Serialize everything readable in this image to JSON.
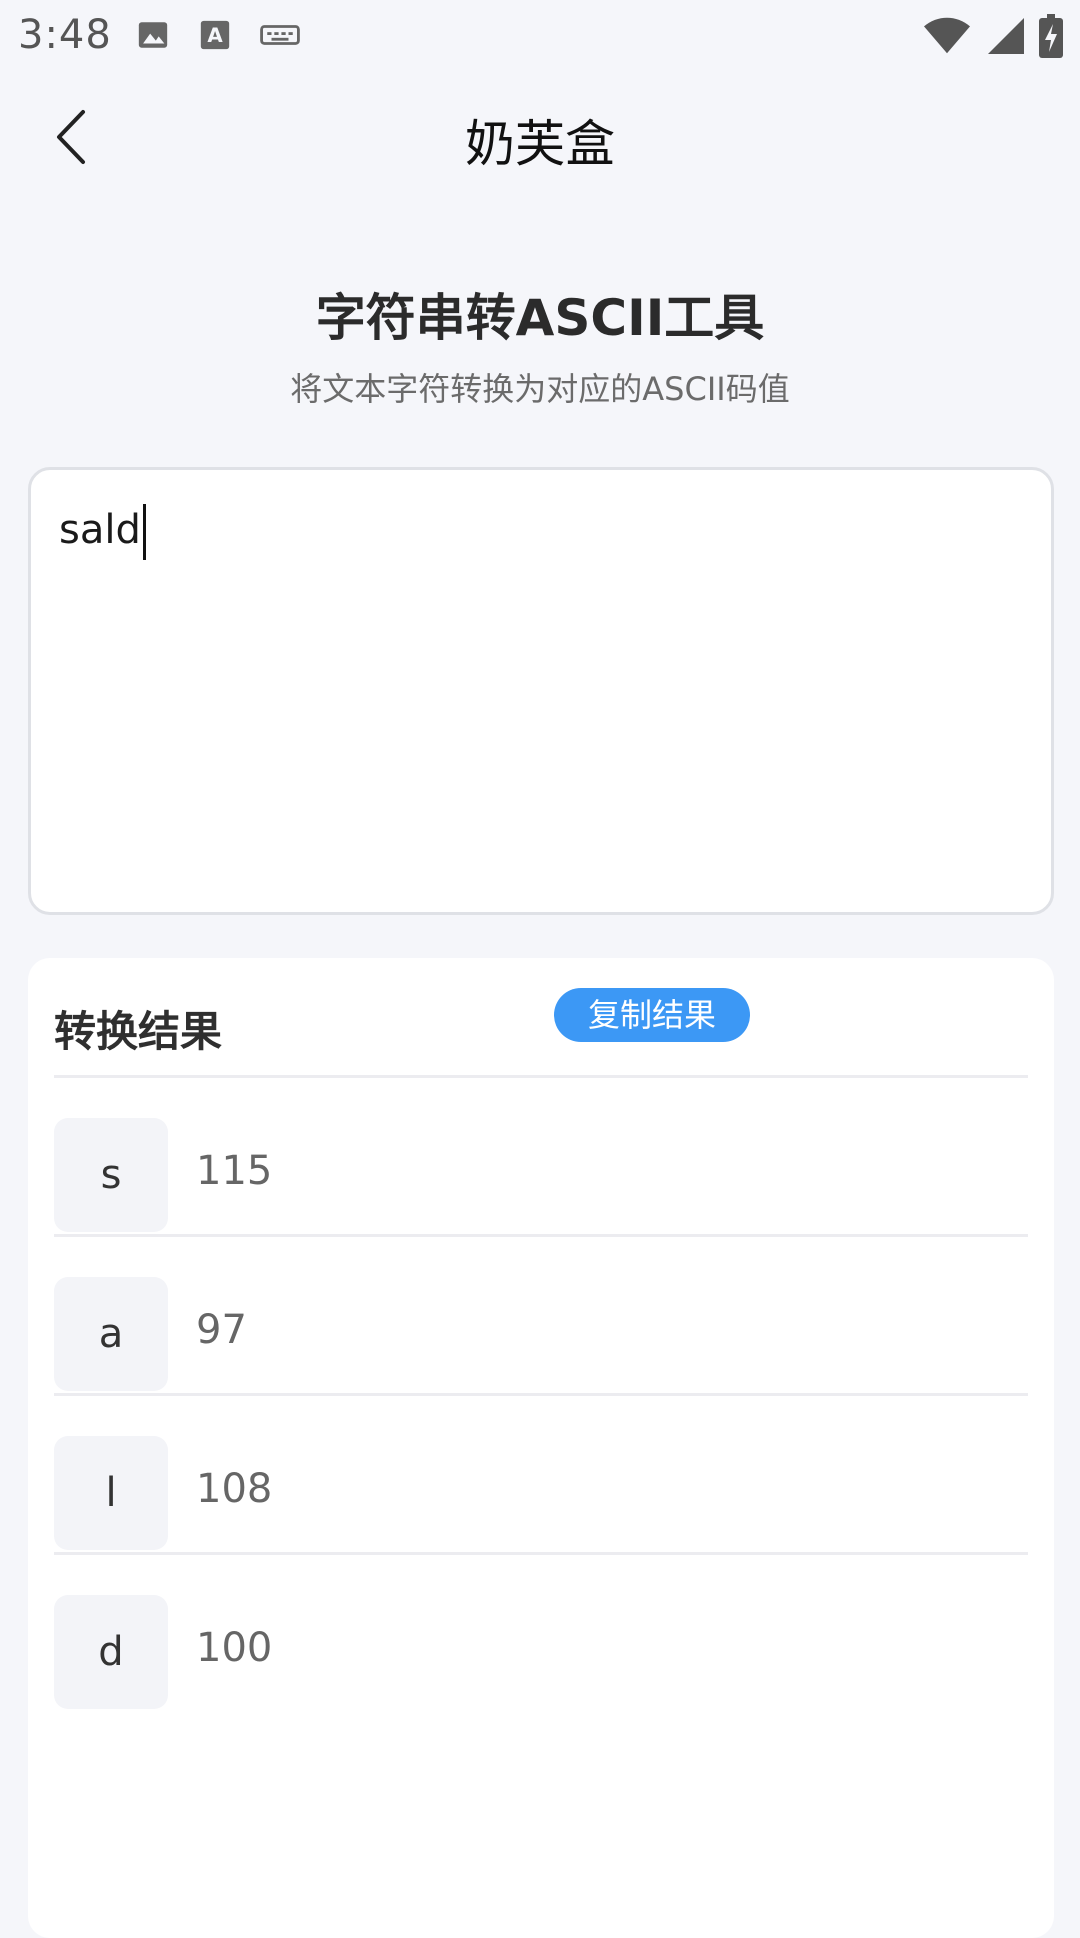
{
  "status_bar": {
    "time": "3:48",
    "left_icons": [
      "image-icon",
      "text-a-icon",
      "keyboard-icon"
    ],
    "right_icons": [
      "wifi-icon",
      "signal-icon",
      "battery-charging-icon"
    ]
  },
  "nav": {
    "title": "奶芙盒",
    "back_icon": "chevron-left-icon"
  },
  "tool": {
    "title": "字符串转ASCII工具",
    "subtitle": "将文本字符转换为对应的ASCII码值"
  },
  "input": {
    "value": "sald"
  },
  "result": {
    "title": "转换结果",
    "copy_label": "复制结果",
    "rows": [
      {
        "char": "s",
        "code": "115"
      },
      {
        "char": "a",
        "code": "97"
      },
      {
        "char": "l",
        "code": "108"
      },
      {
        "char": "d",
        "code": "100"
      }
    ]
  },
  "colors": {
    "accent": "#3c98f5",
    "background": "#f5f6fa",
    "card": "#ffffff"
  }
}
